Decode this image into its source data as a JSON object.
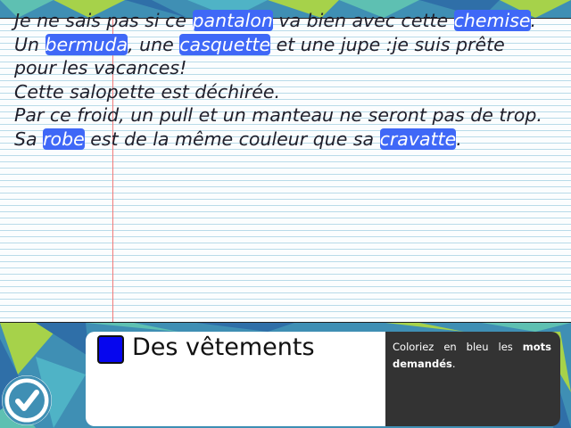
{
  "sentences": [
    {
      "parts": [
        {
          "t": "Je ne sais pas si ce "
        },
        {
          "t": "pantalon",
          "hl": true
        },
        {
          "t": " va bien avec cette "
        },
        {
          "t": "chemise",
          "hl": true
        },
        {
          "t": "."
        }
      ]
    },
    {
      "parts": [
        {
          "t": "Un "
        },
        {
          "t": "bermuda",
          "hl": true
        },
        {
          "t": ", une "
        },
        {
          "t": "casquette",
          "hl": true
        },
        {
          "t": " et une jupe :je suis prête pour les vacances!"
        }
      ]
    },
    {
      "parts": [
        {
          "t": "Cette salopette est déchirée."
        }
      ]
    },
    {
      "parts": [
        {
          "t": "Par ce froid, un pull et un manteau ne seront pas de trop."
        }
      ]
    },
    {
      "parts": [
        {
          "t": "Sa "
        },
        {
          "t": "robe",
          "hl": true
        },
        {
          "t": " est de la même couleur que sa "
        },
        {
          "t": "cravatte",
          "hl": true
        },
        {
          "t": "."
        }
      ]
    }
  ],
  "category": {
    "label": "Des vêtements",
    "color": "#0606ee"
  },
  "instruction": {
    "before": "Coloriez en bleu les ",
    "bold": "mots demandés",
    "after": "."
  },
  "check_button": {
    "icon": "checkmark-icon"
  },
  "colors": {
    "highlight": "#3f68f7",
    "panel": "#333333",
    "check": "#3f8fb4"
  }
}
